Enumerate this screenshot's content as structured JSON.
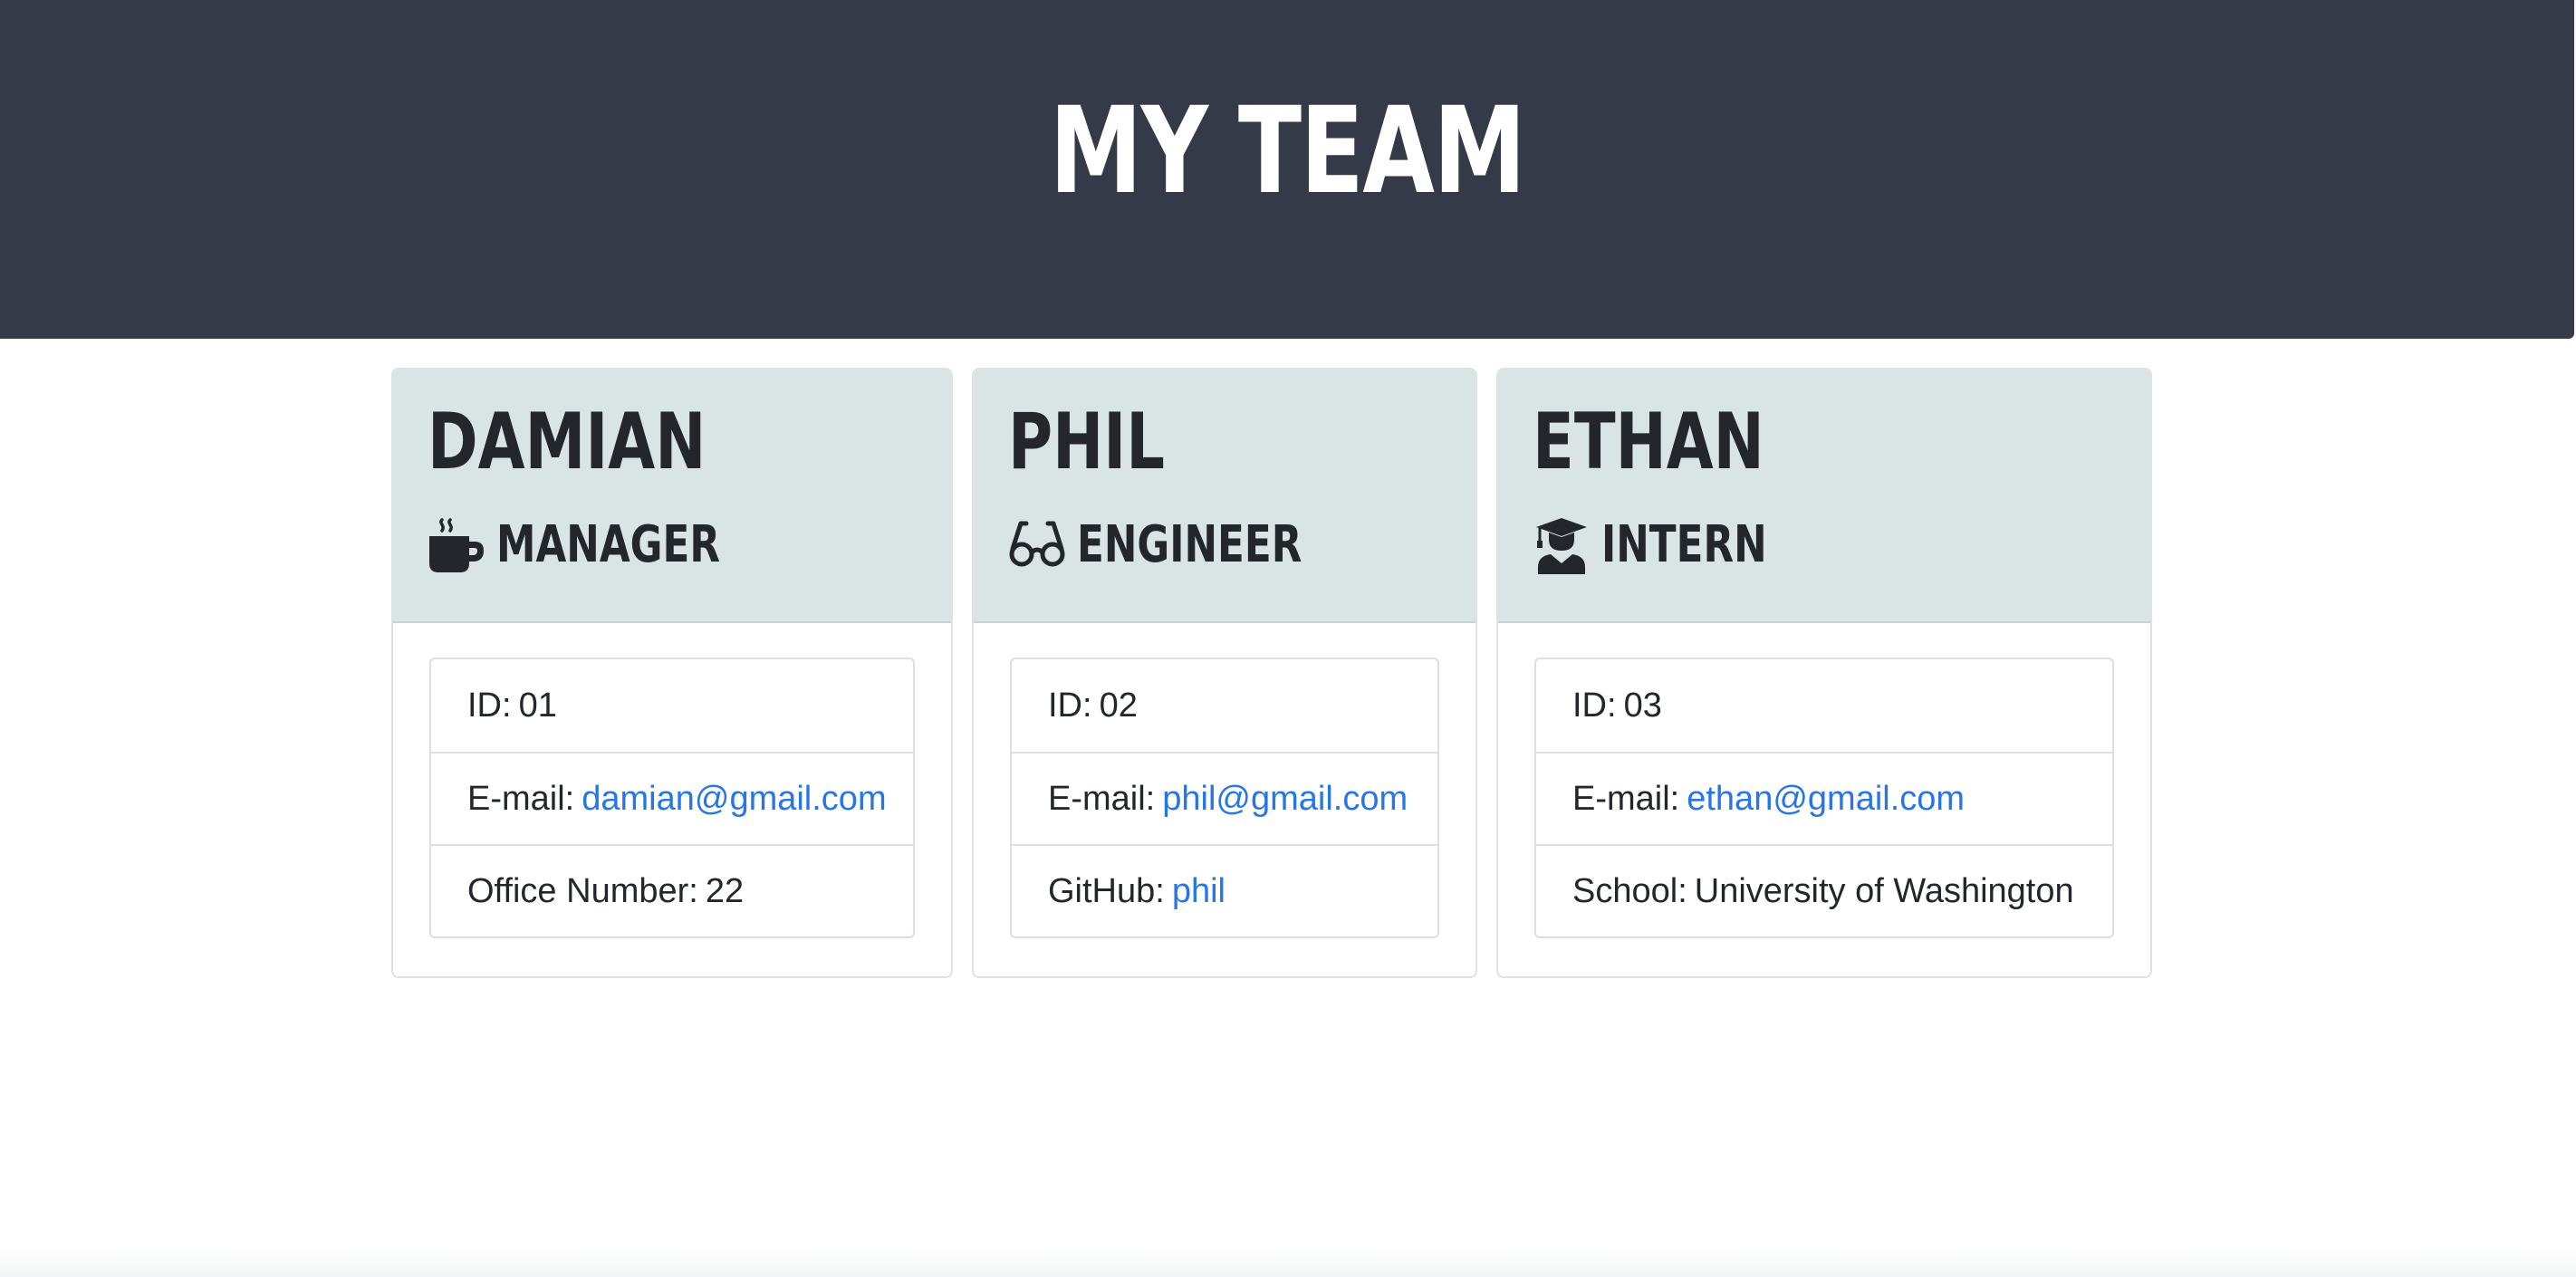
{
  "header": {
    "title": "MY TEAM"
  },
  "colors": {
    "header_bg": "#343a48",
    "card_head_bg": "#d9e5e5",
    "link": "#2876e6",
    "text": "#23272b"
  },
  "employees": [
    {
      "name": "DAMIAN",
      "role": "MANAGER",
      "role_icon": "coffee-mug-icon",
      "id_label": "ID:",
      "id_value": "01",
      "email_label": "E-mail:",
      "email": "damian@gmail.com",
      "extra_label": "Office Number:",
      "extra_value": "22"
    },
    {
      "name": "PHIL",
      "role": "ENGINEER",
      "role_icon": "glasses-icon",
      "id_label": "ID:",
      "id_value": "02",
      "email_label": "E-mail:",
      "email": "phil@gmail.com",
      "extra_label": "GitHub:",
      "extra_value": "phil"
    },
    {
      "name": "ETHAN",
      "role": "INTERN",
      "role_icon": "graduate-icon",
      "id_label": "ID:",
      "id_value": "03",
      "email_label": "E-mail:",
      "email": "ethan@gmail.com",
      "extra_label": "School:",
      "extra_value": "University of Washington"
    }
  ]
}
